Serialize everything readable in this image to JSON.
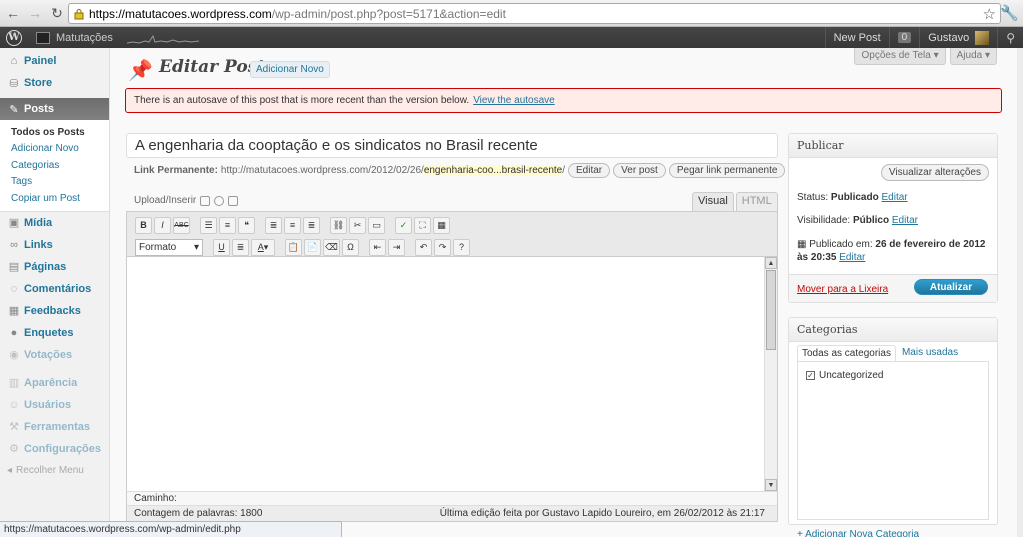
{
  "browser": {
    "url_host": "https://matutacoes.wordpress.com",
    "url_path": "/wp-admin/post.php?post=5171&action=edit"
  },
  "admin_bar": {
    "site_name": "Matutações",
    "new_post": "New Post",
    "count": "0",
    "user": "Gustavo"
  },
  "sidebar": {
    "items": [
      {
        "label": "Painel",
        "icon": "house-icon"
      },
      {
        "label": "Store",
        "icon": "cart-icon"
      },
      {
        "label": "Posts",
        "icon": "pin-icon"
      },
      {
        "label": "Mídia",
        "icon": "media-icon"
      },
      {
        "label": "Links",
        "icon": "link-icon"
      },
      {
        "label": "Páginas",
        "icon": "page-icon"
      },
      {
        "label": "Comentários",
        "icon": "comment-icon"
      },
      {
        "label": "Feedbacks",
        "icon": "feedback-icon"
      },
      {
        "label": "Enquetes",
        "icon": "poll-icon"
      },
      {
        "label": "Votações",
        "icon": "rating-icon"
      },
      {
        "label": "Aparência",
        "icon": "appearance-icon"
      },
      {
        "label": "Usuários",
        "icon": "users-icon"
      },
      {
        "label": "Ferramentas",
        "icon": "tools-icon"
      },
      {
        "label": "Configurações",
        "icon": "settings-icon"
      }
    ],
    "submenu": [
      "Todos os Posts",
      "Adicionar Novo",
      "Categorias",
      "Tags",
      "Copiar um Post"
    ],
    "collapse": "Recolher Menu"
  },
  "screen_meta": {
    "screen_options": "Opções de Tela",
    "help": "Ajuda"
  },
  "page": {
    "title": "Editar Post",
    "add_new": "Adicionar Novo"
  },
  "notice": {
    "text": "There is an autosave of this post that is more recent than the version below.",
    "link": "View the autosave"
  },
  "post": {
    "title": "A engenharia da cooptação e os sindicatos no Brasil recente",
    "permalink_label": "Link Permanente:",
    "permalink_base": "http://matutacoes.wordpress.com/2012/02/26/",
    "permalink_slug": "engenharia-coo...brasil-recente",
    "permalink_trail": "/",
    "edit_btn": "Editar",
    "view_btn": "Ver post",
    "get_link_btn": "Pegar link permanente"
  },
  "editor": {
    "upload_label": "Upload/Inserir",
    "tab_visual": "Visual",
    "tab_html": "HTML",
    "format": "Formato",
    "path_label": "Caminho:",
    "word_count": "Contagem de palavras: 1800",
    "last_edit": "Última edição feita por Gustavo Lapido Loureiro, em 26/02/2012 às 21:17"
  },
  "publish": {
    "title": "Publicar",
    "preview": "Visualizar alterações",
    "status_label": "Status:",
    "status_value": "Publicado",
    "visibility_label": "Visibilidade:",
    "visibility_value": "Público",
    "published_label": "Publicado em:",
    "published_value": "26 de fevereiro de 2012 às 20:35",
    "edit": "Editar",
    "trash": "Mover para a Lixeira",
    "update": "Atualizar"
  },
  "categories": {
    "title": "Categorias",
    "tab_all": "Todas as categorias",
    "tab_used": "Mais usadas",
    "item": "Uncategorized",
    "add_new": "+ Adicionar Nova Categoria"
  },
  "status_bar": {
    "text": "https://matutacoes.wordpress.com/wp-admin/edit.php"
  }
}
